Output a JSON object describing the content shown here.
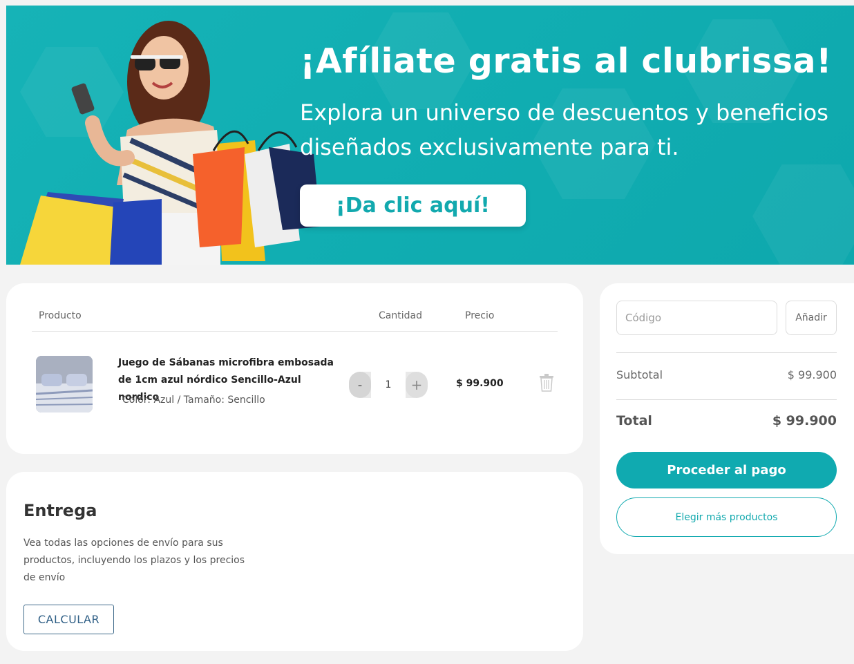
{
  "banner": {
    "title": "¡Afíliate gratis al clubrissa!",
    "subtitle": "Explora un universo de descuentos y beneficios diseñados exclusivamente para ti.",
    "cta_label": "¡Da clic aquí!",
    "background_color": "#12adb1"
  },
  "cart": {
    "columns": {
      "product": "Producto",
      "quantity": "Cantidad",
      "price": "Precio"
    },
    "items": [
      {
        "name": "Juego de Sábanas microfibra embosada de 1cm azul nórdico Sencillo-Azul nordico",
        "variant": "Color: Azul / Tamaño: Sencillo",
        "quantity": "1",
        "minus_label": "-",
        "plus_label": "+",
        "price": "$ 99.900",
        "remove_icon": "trash-icon"
      }
    ]
  },
  "delivery": {
    "title": "Entrega",
    "description": "Vea todas las opciones de envío para sus productos, incluyendo los plazos y los precios de envío",
    "calculate_label": "CALCULAR"
  },
  "summary": {
    "code_placeholder": "Código",
    "add_label": "Añadir",
    "subtotal_label": "Subtotal",
    "subtotal_value": "$ 99.900",
    "total_label": "Total",
    "total_value": "$ 99.900",
    "pay_label": "Proceder al pago",
    "more_products_label": "Elegir más productos",
    "accent_color": "#10aab0"
  }
}
